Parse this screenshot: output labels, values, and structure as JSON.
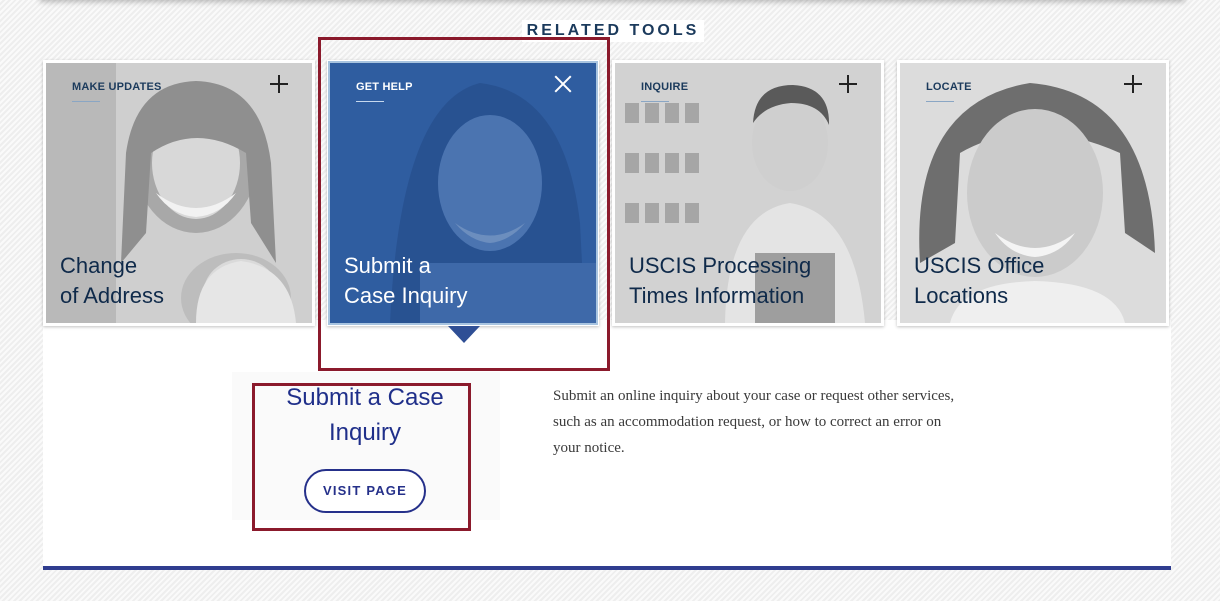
{
  "section": {
    "title": "RELATED TOOLS"
  },
  "cards": [
    {
      "category": "MAKE UPDATES",
      "title_line1": "Change",
      "title_line2": "of Address",
      "icon": "plus-icon"
    },
    {
      "category": "GET HELP",
      "title_line1": "Submit a",
      "title_line2": "Case Inquiry",
      "icon": "close-icon",
      "active": true
    },
    {
      "category": "INQUIRE",
      "title_line1": "USCIS Processing",
      "title_line2": "Times Information",
      "icon": "plus-icon"
    },
    {
      "category": "LOCATE",
      "title_line1": "USCIS Office",
      "title_line2": "Locations",
      "icon": "plus-icon"
    }
  ],
  "detail": {
    "title_line1": "Submit a Case",
    "title_line2": "Inquiry",
    "button_label": "VISIT PAGE",
    "description_line1": "Submit an online inquiry about your case or request other services,",
    "description_line2": "such as an accommodation request, or how to correct an error on",
    "description_line3": "your notice."
  },
  "colors": {
    "accent": "#2f5da0",
    "brand_navy": "#1f2f8a",
    "highlight": "#8b1a2c",
    "rule": "#2f3d8f"
  }
}
